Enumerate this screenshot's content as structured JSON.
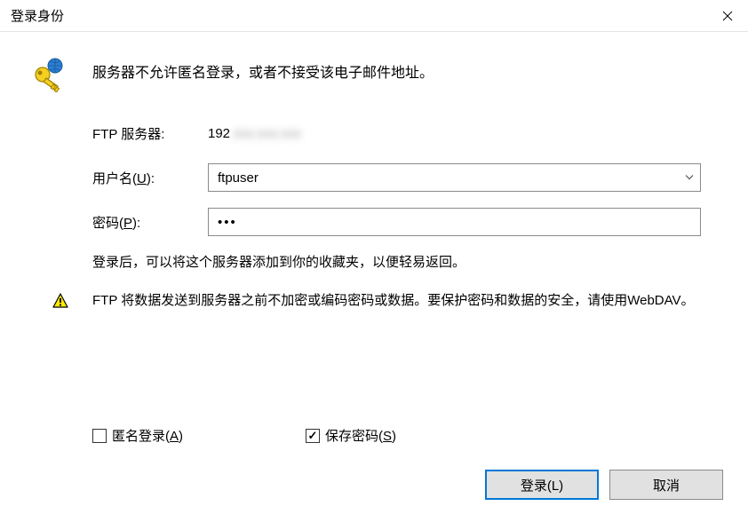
{
  "titlebar": {
    "title": "登录身份"
  },
  "message": "服务器不允许匿名登录，或者不接受该电子邮件地址。",
  "form": {
    "server_label": "FTP 服务器:",
    "server_value_visible": "192",
    "server_value_hidden": ".xxx.xxx.xxx",
    "username_label_prefix": "用户名(",
    "username_label_key": "U",
    "username_label_suffix": "):",
    "username_value": "ftpuser",
    "password_label_prefix": "密码(",
    "password_label_key": "P",
    "password_label_suffix": "):",
    "password_value": "•••"
  },
  "info_text": "登录后，可以将这个服务器添加到你的收藏夹，以便轻易返回。",
  "warning_text": "FTP 将数据发送到服务器之前不加密或编码密码或数据。要保护密码和数据的安全，请使用WebDAV。",
  "checkboxes": {
    "anonymous_prefix": "匿名登录(",
    "anonymous_key": "A",
    "anonymous_suffix": ")",
    "anonymous_checked": false,
    "savepwd_prefix": "保存密码(",
    "savepwd_key": "S",
    "savepwd_suffix": ")",
    "savepwd_checked": true
  },
  "buttons": {
    "login": "登录(L)",
    "cancel": "取消"
  }
}
